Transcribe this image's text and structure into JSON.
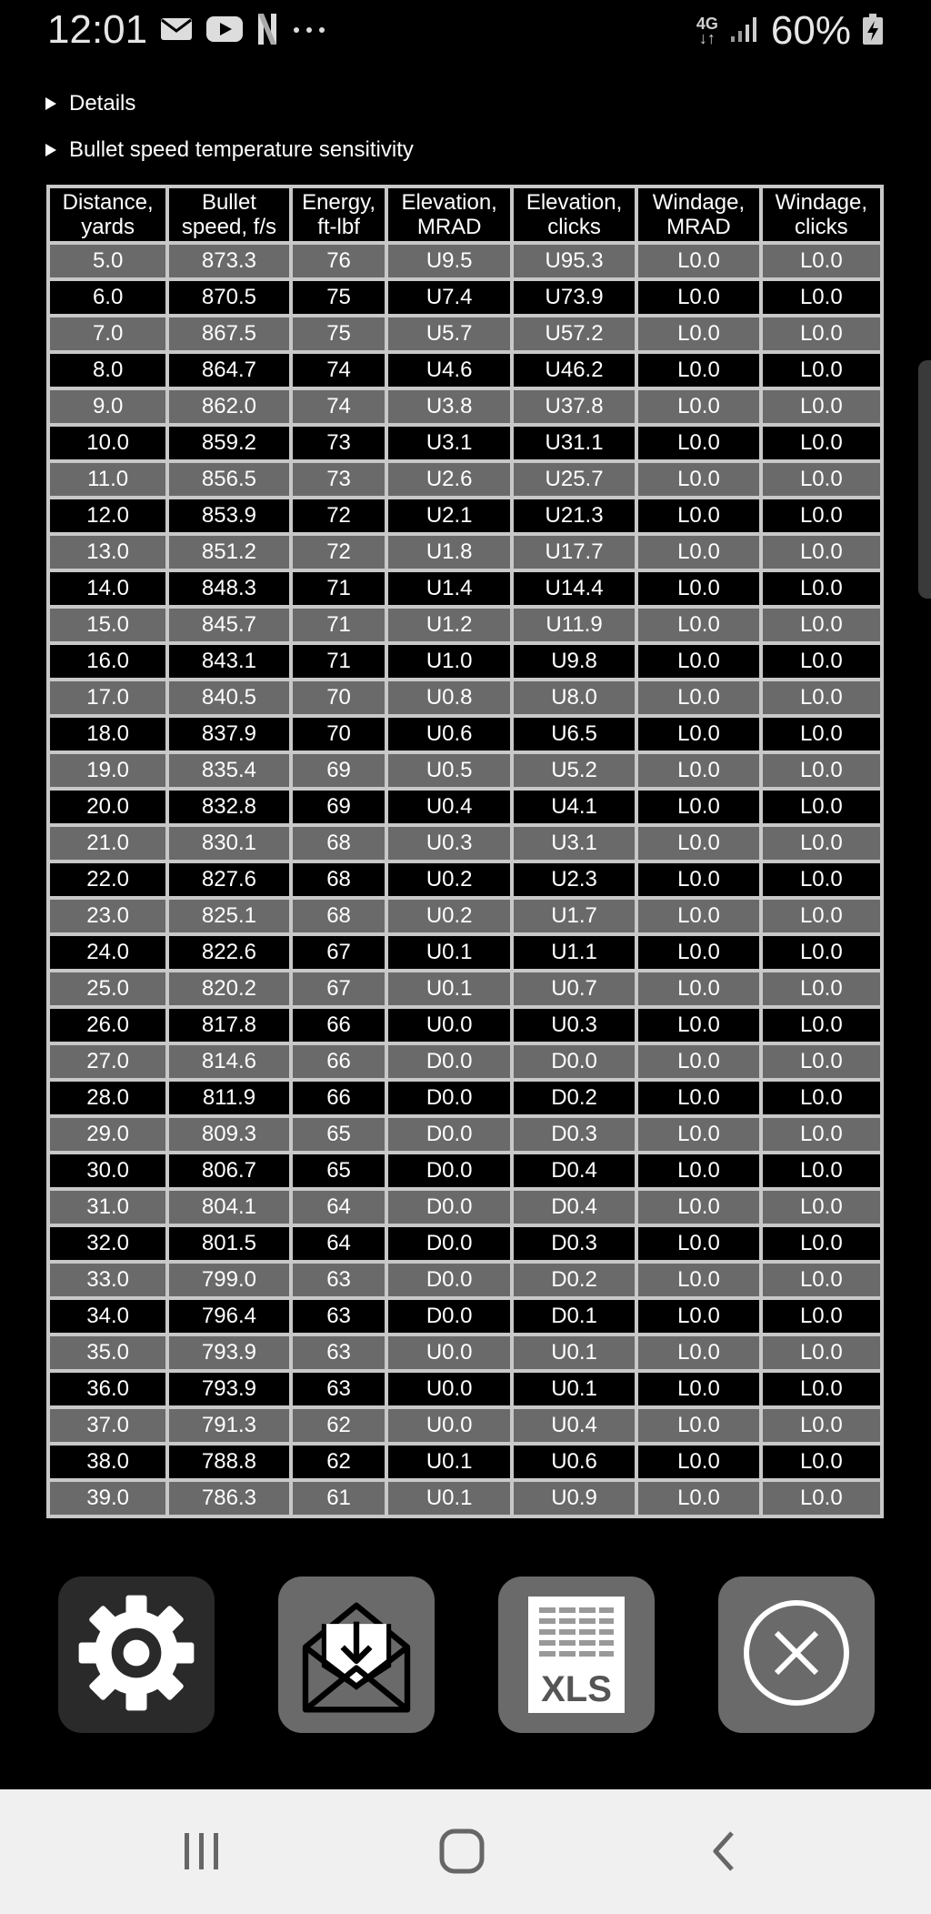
{
  "status_bar": {
    "time": "12:01",
    "network": "4G",
    "battery": "60%",
    "icons": [
      "mail-icon",
      "youtube-icon",
      "netflix-icon",
      "more-dots-icon",
      "signal-icon",
      "battery-charging-icon"
    ]
  },
  "details_label": "Details",
  "sensitivity_label": "Bullet speed temperature sensitivity",
  "table": {
    "headers": [
      [
        "Distance,",
        "yards"
      ],
      [
        "Bullet",
        "speed, f/s"
      ],
      [
        "Energy,",
        "ft-lbf"
      ],
      [
        "Elevation,",
        "MRAD"
      ],
      [
        "Elevation,",
        "clicks"
      ],
      [
        "Windage,",
        "MRAD"
      ],
      [
        "Windage,",
        "clicks"
      ]
    ],
    "rows": [
      [
        "5.0",
        "873.3",
        "76",
        "U9.5",
        "U95.3",
        "L0.0",
        "L0.0"
      ],
      [
        "6.0",
        "870.5",
        "75",
        "U7.4",
        "U73.9",
        "L0.0",
        "L0.0"
      ],
      [
        "7.0",
        "867.5",
        "75",
        "U5.7",
        "U57.2",
        "L0.0",
        "L0.0"
      ],
      [
        "8.0",
        "864.7",
        "74",
        "U4.6",
        "U46.2",
        "L0.0",
        "L0.0"
      ],
      [
        "9.0",
        "862.0",
        "74",
        "U3.8",
        "U37.8",
        "L0.0",
        "L0.0"
      ],
      [
        "10.0",
        "859.2",
        "73",
        "U3.1",
        "U31.1",
        "L0.0",
        "L0.0"
      ],
      [
        "11.0",
        "856.5",
        "73",
        "U2.6",
        "U25.7",
        "L0.0",
        "L0.0"
      ],
      [
        "12.0",
        "853.9",
        "72",
        "U2.1",
        "U21.3",
        "L0.0",
        "L0.0"
      ],
      [
        "13.0",
        "851.2",
        "72",
        "U1.8",
        "U17.7",
        "L0.0",
        "L0.0"
      ],
      [
        "14.0",
        "848.3",
        "71",
        "U1.4",
        "U14.4",
        "L0.0",
        "L0.0"
      ],
      [
        "15.0",
        "845.7",
        "71",
        "U1.2",
        "U11.9",
        "L0.0",
        "L0.0"
      ],
      [
        "16.0",
        "843.1",
        "71",
        "U1.0",
        "U9.8",
        "L0.0",
        "L0.0"
      ],
      [
        "17.0",
        "840.5",
        "70",
        "U0.8",
        "U8.0",
        "L0.0",
        "L0.0"
      ],
      [
        "18.0",
        "837.9",
        "70",
        "U0.6",
        "U6.5",
        "L0.0",
        "L0.0"
      ],
      [
        "19.0",
        "835.4",
        "69",
        "U0.5",
        "U5.2",
        "L0.0",
        "L0.0"
      ],
      [
        "20.0",
        "832.8",
        "69",
        "U0.4",
        "U4.1",
        "L0.0",
        "L0.0"
      ],
      [
        "21.0",
        "830.1",
        "68",
        "U0.3",
        "U3.1",
        "L0.0",
        "L0.0"
      ],
      [
        "22.0",
        "827.6",
        "68",
        "U0.2",
        "U2.3",
        "L0.0",
        "L0.0"
      ],
      [
        "23.0",
        "825.1",
        "68",
        "U0.2",
        "U1.7",
        "L0.0",
        "L0.0"
      ],
      [
        "24.0",
        "822.6",
        "67",
        "U0.1",
        "U1.1",
        "L0.0",
        "L0.0"
      ],
      [
        "25.0",
        "820.2",
        "67",
        "U0.1",
        "U0.7",
        "L0.0",
        "L0.0"
      ],
      [
        "26.0",
        "817.8",
        "66",
        "U0.0",
        "U0.3",
        "L0.0",
        "L0.0"
      ],
      [
        "27.0",
        "814.6",
        "66",
        "D0.0",
        "D0.0",
        "L0.0",
        "L0.0"
      ],
      [
        "28.0",
        "811.9",
        "66",
        "D0.0",
        "D0.2",
        "L0.0",
        "L0.0"
      ],
      [
        "29.0",
        "809.3",
        "65",
        "D0.0",
        "D0.3",
        "L0.0",
        "L0.0"
      ],
      [
        "30.0",
        "806.7",
        "65",
        "D0.0",
        "D0.4",
        "L0.0",
        "L0.0"
      ],
      [
        "31.0",
        "804.1",
        "64",
        "D0.0",
        "D0.4",
        "L0.0",
        "L0.0"
      ],
      [
        "32.0",
        "801.5",
        "64",
        "D0.0",
        "D0.3",
        "L0.0",
        "L0.0"
      ],
      [
        "33.0",
        "799.0",
        "63",
        "D0.0",
        "D0.2",
        "L0.0",
        "L0.0"
      ],
      [
        "34.0",
        "796.4",
        "63",
        "D0.0",
        "D0.1",
        "L0.0",
        "L0.0"
      ],
      [
        "35.0",
        "793.9",
        "63",
        "U0.0",
        "U0.1",
        "L0.0",
        "L0.0"
      ],
      [
        "36.0",
        "793.9",
        "63",
        "U0.0",
        "U0.1",
        "L0.0",
        "L0.0"
      ],
      [
        "37.0",
        "791.3",
        "62",
        "U0.0",
        "U0.4",
        "L0.0",
        "L0.0"
      ],
      [
        "38.0",
        "788.8",
        "62",
        "U0.1",
        "U0.6",
        "L0.0",
        "L0.0"
      ],
      [
        "39.0",
        "786.3",
        "61",
        "U0.1",
        "U0.9",
        "L0.0",
        "L0.0"
      ]
    ]
  },
  "toolbar": {
    "buttons": [
      "gear-icon",
      "email-download-icon",
      "xls-icon",
      "close-circle-icon"
    ],
    "xls_label": "XLS"
  },
  "colors": {
    "background": "#000000",
    "row_grey": "#6a6a6a",
    "grid_line": "#c8c8c8",
    "button_grey": "#6a6a6a",
    "navbar": "#f0f0f0"
  }
}
